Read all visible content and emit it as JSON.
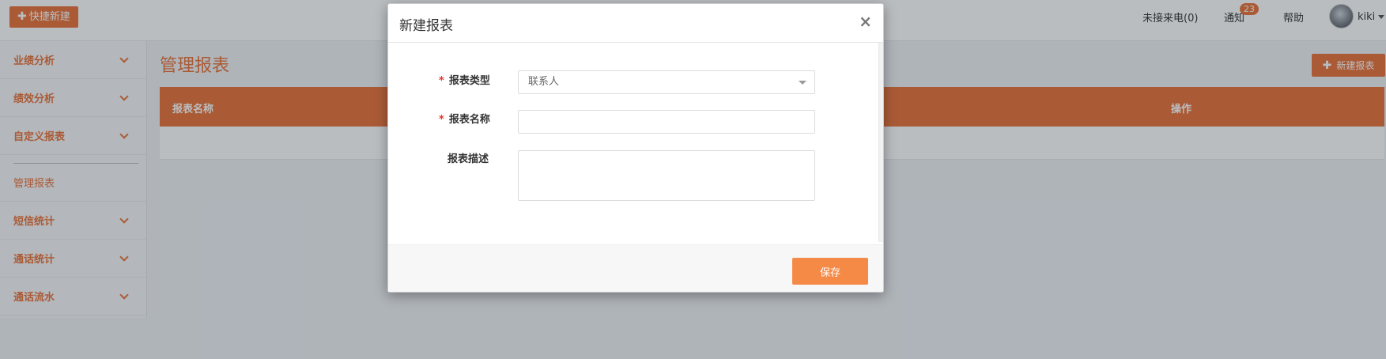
{
  "topbar": {
    "quick_new_label": "快捷新建",
    "missed_calls": "未接来电(0)",
    "notice_label": "通知",
    "notice_count": "23",
    "help_label": "帮助",
    "username": "kiki"
  },
  "sidebar": {
    "items": [
      {
        "label": "业绩分析"
      },
      {
        "label": "绩效分析"
      },
      {
        "label": "自定义报表"
      }
    ],
    "manage_label": "管理报表",
    "items_after": [
      {
        "label": "短信统计"
      },
      {
        "label": "通话统计"
      },
      {
        "label": "通话流水"
      }
    ]
  },
  "main": {
    "title": "管理报表",
    "new_report_label": "新建报表",
    "table": {
      "columns": [
        "报表名称",
        "操作"
      ]
    }
  },
  "modal": {
    "title": "新建报表",
    "close_symbol": "×",
    "fields": {
      "type_label": "报表类型",
      "type_value": "联系人",
      "name_label": "报表名称",
      "name_value": "",
      "desc_label": "报表描述",
      "desc_value": ""
    },
    "required_mark": "*",
    "save_label": "保存"
  },
  "colors": {
    "accent": "#e8733a",
    "save_button": "#f58a47",
    "required": "#e8332b"
  }
}
